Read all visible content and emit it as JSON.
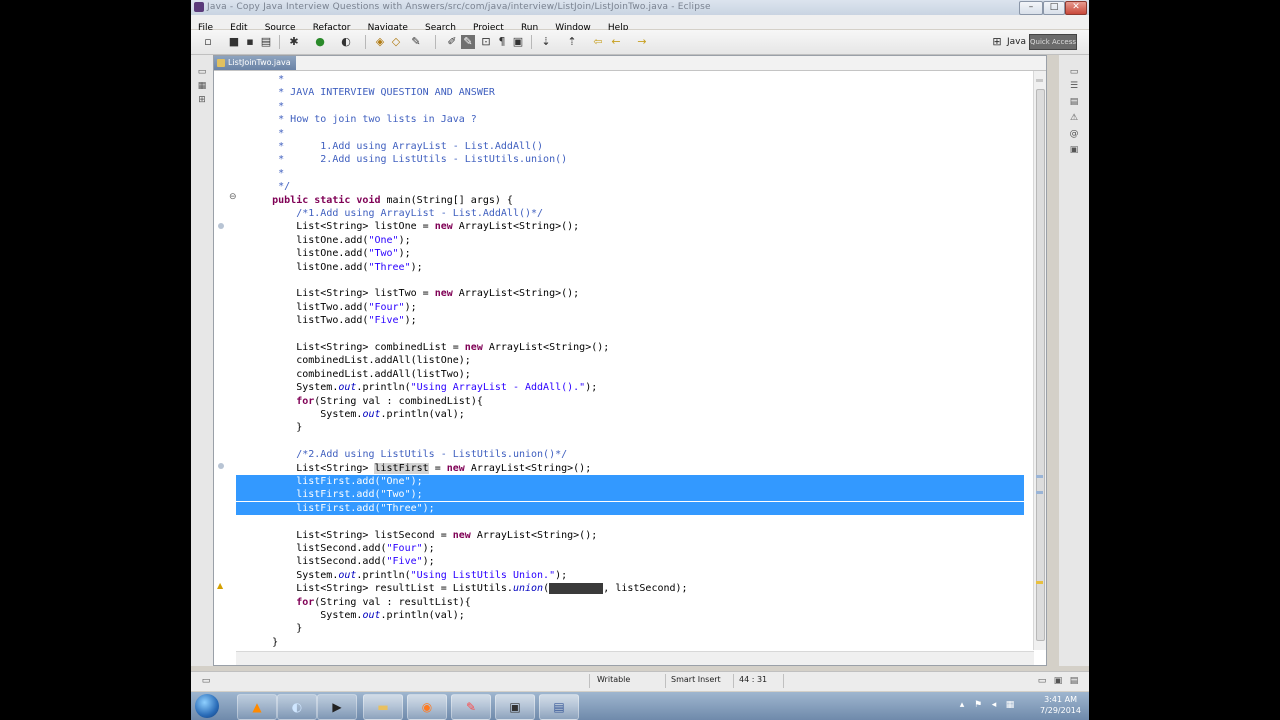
{
  "window": {
    "title": "Java - Copy Java Interview Questions with Answers/src/com/java/interview/ListJoin/ListJoinTwo.java - Eclipse",
    "minimize": "–",
    "maximize": "□",
    "close": "✕"
  },
  "menu": [
    "File",
    "Edit",
    "Source",
    "Refactor",
    "Navigate",
    "Search",
    "Project",
    "Run",
    "Window",
    "Help"
  ],
  "toolbar": {
    "perspective_label": "Java",
    "quick_access": "Quick Access"
  },
  "editor": {
    "tab_label": "ListJoinTwo.java"
  },
  "code": {
    "lines": [
      {
        "segments": [
          {
            "t": "       *",
            "c": "cm"
          }
        ]
      },
      {
        "segments": [
          {
            "t": "       * JAVA INTERVIEW QUESTION AND ANSWER",
            "c": "cm"
          }
        ]
      },
      {
        "segments": [
          {
            "t": "       *",
            "c": "cm"
          }
        ]
      },
      {
        "segments": [
          {
            "t": "       * How to join two lists in Java ?",
            "c": "cm"
          }
        ]
      },
      {
        "segments": [
          {
            "t": "       *",
            "c": "cm"
          }
        ]
      },
      {
        "segments": [
          {
            "t": "       *      1.Add using ArrayList - List.AddAll()",
            "c": "cm"
          }
        ]
      },
      {
        "segments": [
          {
            "t": "       *      2.Add using ListUtils - ListUtils.union()",
            "c": "cm"
          }
        ]
      },
      {
        "segments": [
          {
            "t": "       *",
            "c": "cm"
          }
        ]
      },
      {
        "segments": [
          {
            "t": "       */",
            "c": "cm"
          }
        ]
      },
      {
        "segments": [
          {
            "t": "      ",
            "c": ""
          },
          {
            "t": "public static void",
            "c": "kw"
          },
          {
            "t": " main(String[] args) {",
            "c": ""
          }
        ]
      },
      {
        "segments": [
          {
            "t": "          ",
            "c": ""
          },
          {
            "t": "/*1.Add using ArrayList - List.AddAll()*/",
            "c": "cm"
          }
        ]
      },
      {
        "segments": [
          {
            "t": "          List<String> listOne = ",
            "c": ""
          },
          {
            "t": "new",
            "c": "kw"
          },
          {
            "t": " ArrayList<String>();",
            "c": ""
          }
        ]
      },
      {
        "segments": [
          {
            "t": "          listOne.add(",
            "c": ""
          },
          {
            "t": "\"One\"",
            "c": "str"
          },
          {
            "t": ");",
            "c": ""
          }
        ]
      },
      {
        "segments": [
          {
            "t": "          listOne.add(",
            "c": ""
          },
          {
            "t": "\"Two\"",
            "c": "str"
          },
          {
            "t": ");",
            "c": ""
          }
        ]
      },
      {
        "segments": [
          {
            "t": "          listOne.add(",
            "c": ""
          },
          {
            "t": "\"Three\"",
            "c": "str"
          },
          {
            "t": ");",
            "c": ""
          }
        ]
      },
      {
        "segments": [
          {
            "t": "",
            "c": ""
          }
        ]
      },
      {
        "segments": [
          {
            "t": "          List<String> listTwo = ",
            "c": ""
          },
          {
            "t": "new",
            "c": "kw"
          },
          {
            "t": " ArrayList<String>();",
            "c": ""
          }
        ]
      },
      {
        "segments": [
          {
            "t": "          listTwo.add(",
            "c": ""
          },
          {
            "t": "\"Four\"",
            "c": "str"
          },
          {
            "t": ");",
            "c": ""
          }
        ]
      },
      {
        "segments": [
          {
            "t": "          listTwo.add(",
            "c": ""
          },
          {
            "t": "\"Five\"",
            "c": "str"
          },
          {
            "t": ");",
            "c": ""
          }
        ]
      },
      {
        "segments": [
          {
            "t": "",
            "c": ""
          }
        ]
      },
      {
        "segments": [
          {
            "t": "          List<String> combinedList = ",
            "c": ""
          },
          {
            "t": "new",
            "c": "kw"
          },
          {
            "t": " ArrayList<String>();",
            "c": ""
          }
        ]
      },
      {
        "segments": [
          {
            "t": "          combinedList.addAll(listOne);",
            "c": ""
          }
        ]
      },
      {
        "segments": [
          {
            "t": "          combinedList.addAll(listTwo);",
            "c": ""
          }
        ]
      },
      {
        "segments": [
          {
            "t": "          System.",
            "c": ""
          },
          {
            "t": "out",
            "c": "it"
          },
          {
            "t": ".println(",
            "c": ""
          },
          {
            "t": "\"Using ArrayList - AddAll().\"",
            "c": "str"
          },
          {
            "t": ");",
            "c": ""
          }
        ]
      },
      {
        "segments": [
          {
            "t": "          ",
            "c": ""
          },
          {
            "t": "for",
            "c": "kw"
          },
          {
            "t": "(String val : combinedList){",
            "c": ""
          }
        ]
      },
      {
        "segments": [
          {
            "t": "              System.",
            "c": ""
          },
          {
            "t": "out",
            "c": "it"
          },
          {
            "t": ".println(val);",
            "c": ""
          }
        ]
      },
      {
        "segments": [
          {
            "t": "          }",
            "c": ""
          }
        ]
      },
      {
        "segments": [
          {
            "t": "",
            "c": ""
          }
        ]
      },
      {
        "segments": [
          {
            "t": "          ",
            "c": ""
          },
          {
            "t": "/*2.Add using ListUtils - ListUtils.union()*/",
            "c": "cm"
          }
        ]
      },
      {
        "segments": [
          {
            "t": "          List<String> ",
            "c": ""
          },
          {
            "t": "listFirst",
            "c": "occ"
          },
          {
            "t": " = ",
            "c": ""
          },
          {
            "t": "new",
            "c": "kw"
          },
          {
            "t": " ArrayList<String>();",
            "c": ""
          }
        ]
      },
      {
        "sel": true,
        "segments": [
          {
            "t": "          listFirst.add(\"One\");",
            "c": ""
          }
        ]
      },
      {
        "sel": true,
        "segments": [
          {
            "t": "          listFirst.add(\"Two\");",
            "c": ""
          }
        ]
      },
      {
        "sel": true,
        "segments": [
          {
            "t": "          listFirst.add(\"Three\");",
            "c": ""
          }
        ]
      },
      {
        "segments": [
          {
            "t": "",
            "c": ""
          }
        ]
      },
      {
        "segments": [
          {
            "t": "          List<String> listSecond = ",
            "c": ""
          },
          {
            "t": "new",
            "c": "kw"
          },
          {
            "t": " ArrayList<String>();",
            "c": ""
          }
        ]
      },
      {
        "segments": [
          {
            "t": "          listSecond.add(",
            "c": ""
          },
          {
            "t": "\"Four\"",
            "c": "str"
          },
          {
            "t": ");",
            "c": ""
          }
        ]
      },
      {
        "segments": [
          {
            "t": "          listSecond.add(",
            "c": ""
          },
          {
            "t": "\"Five\"",
            "c": "str"
          },
          {
            "t": ");",
            "c": ""
          }
        ]
      },
      {
        "segments": [
          {
            "t": "          System.",
            "c": ""
          },
          {
            "t": "out",
            "c": "it"
          },
          {
            "t": ".println(",
            "c": ""
          },
          {
            "t": "\"Using ListUtils Union.\"",
            "c": "str"
          },
          {
            "t": ");",
            "c": ""
          }
        ]
      },
      {
        "segments": [
          {
            "t": "          List<String> resultList = ListUtils.",
            "c": ""
          },
          {
            "t": "union",
            "c": "it"
          },
          {
            "t": "(",
            "c": ""
          },
          {
            "t": "listFirst",
            "c": "hl-dark"
          },
          {
            "t": ", listSecond);",
            "c": ""
          }
        ]
      },
      {
        "segments": [
          {
            "t": "          ",
            "c": ""
          },
          {
            "t": "for",
            "c": "kw"
          },
          {
            "t": "(String val : resultList){",
            "c": ""
          }
        ]
      },
      {
        "segments": [
          {
            "t": "              System.",
            "c": ""
          },
          {
            "t": "out",
            "c": "it"
          },
          {
            "t": ".println(val);",
            "c": ""
          }
        ]
      },
      {
        "segments": [
          {
            "t": "          }",
            "c": ""
          }
        ]
      },
      {
        "segments": [
          {
            "t": "      }",
            "c": ""
          }
        ]
      }
    ]
  },
  "status": {
    "writable": "Writable",
    "insert_mode": "Smart Insert",
    "position": "44 : 31"
  },
  "taskbar": {
    "time": "3:41 AM",
    "date": "7/29/2014",
    "apps": [
      "vlc-icon",
      "eclipse-icon",
      "media-player-icon",
      "folder-icon",
      "firefox-icon",
      "paint-icon",
      "recorder-icon",
      "save-icon"
    ]
  }
}
